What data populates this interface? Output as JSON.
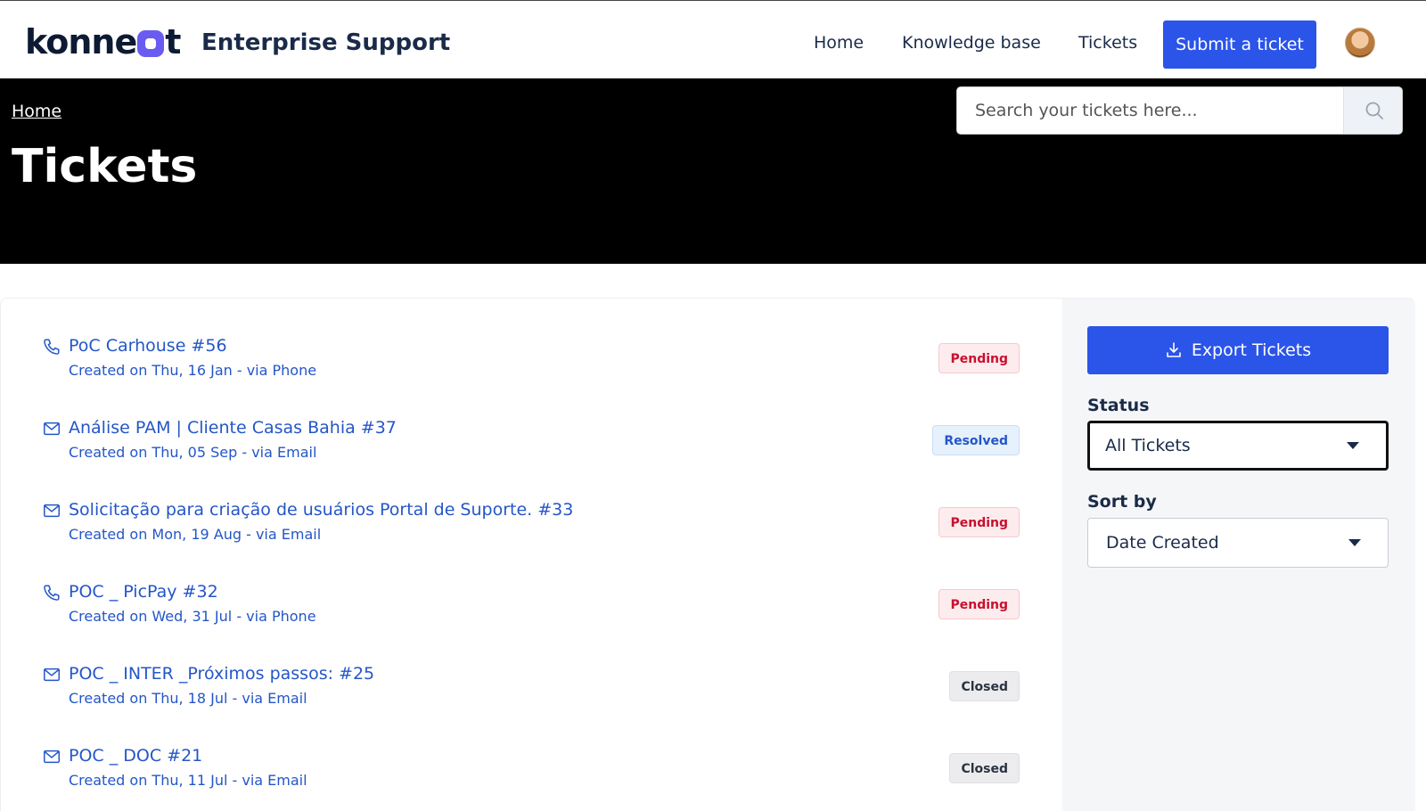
{
  "header": {
    "logo_left": "konne",
    "logo_right": "t",
    "brand_title": "Enterprise Support",
    "nav": [
      "Home",
      "Knowledge base",
      "Tickets"
    ],
    "submit_label": "Submit a ticket"
  },
  "hero": {
    "breadcrumb": "Home",
    "title": "Tickets",
    "search_placeholder": "Search your tickets here..."
  },
  "tickets": [
    {
      "icon": "phone-icon",
      "title": "PoC Carhouse #56",
      "meta": "Created on Thu, 16 Jan - via Phone",
      "status": "Pending"
    },
    {
      "icon": "mail-icon",
      "title": "Análise PAM | Cliente Casas Bahia #37",
      "meta": "Created on Thu, 05 Sep - via Email",
      "status": "Resolved"
    },
    {
      "icon": "mail-icon",
      "title": "Solicitação para criação de usuários Portal de Suporte. #33",
      "meta": "Created on Mon, 19 Aug - via Email",
      "status": "Pending"
    },
    {
      "icon": "phone-icon",
      "title": "POC _ PicPay #32",
      "meta": "Created on Wed, 31 Jul - via Phone",
      "status": "Pending"
    },
    {
      "icon": "mail-icon",
      "title": "POC _ INTER _Próximos passos: #25",
      "meta": "Created on Thu, 18 Jul - via Email",
      "status": "Closed"
    },
    {
      "icon": "mail-icon",
      "title": "POC _ DOC #21",
      "meta": "Created on Thu, 11 Jul - via Email",
      "status": "Closed"
    }
  ],
  "sidebar": {
    "export_label": "Export Tickets",
    "status_label": "Status",
    "status_value": "All Tickets",
    "sort_label": "Sort by",
    "sort_value": "Date Created"
  },
  "colors": {
    "primary": "#2b54e8",
    "link": "#2456c8",
    "pending": "#c8102e",
    "hero_bg": "#000000"
  }
}
